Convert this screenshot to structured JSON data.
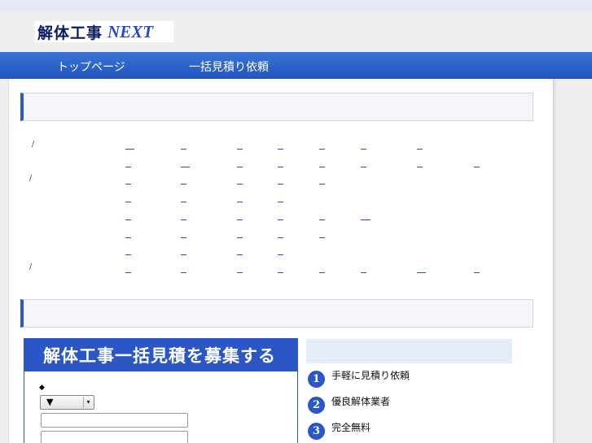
{
  "header": {
    "logo_jp": "解体工事",
    "logo_en": "NEXT"
  },
  "nav": {
    "items": [
      "トップページ",
      "一括見積り依頼"
    ]
  },
  "list": {
    "slashes": [
      "/",
      "/",
      "/"
    ]
  },
  "form_panel": {
    "title": "解体工事一括見積を募集する",
    "bullet": "◆",
    "select_value": "▼",
    "select_arrow": "▾"
  },
  "features": {
    "items": [
      {
        "num": "1",
        "label": "手軽に見積り依頼"
      },
      {
        "num": "2",
        "label": "優良解体業者"
      },
      {
        "num": "3",
        "label": "完全無料"
      }
    ]
  },
  "colors": {
    "accent": "#2a56c6",
    "nav": "#2a63cc"
  }
}
